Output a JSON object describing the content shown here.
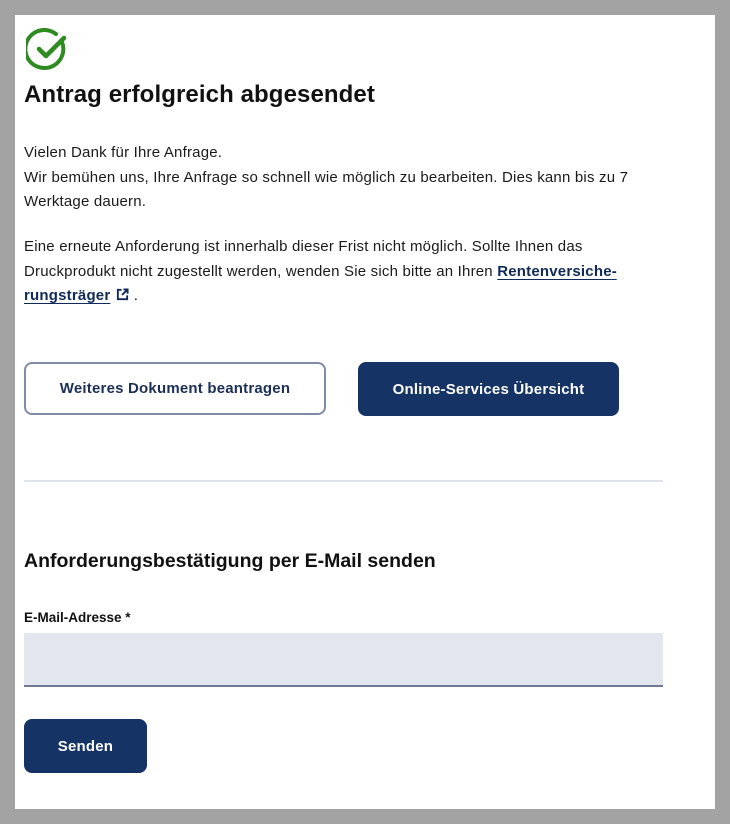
{
  "confirmation": {
    "icon": "check-circle-icon",
    "icon_color": "#2e8b20",
    "title": "Antrag erfolgreich abgesendet",
    "paragraph1": {
      "line1": "Vielen Dank für Ihre Anfrage.",
      "line2": "Wir bemühen uns, Ihre Anfrage so schnell wie möglich zu bearbeiten. Dies kann bis zu 7 Werktage dauern."
    },
    "paragraph2": {
      "text_before_link": "Eine erneute Anforderung ist innerhalb dieser Frist nicht möglich. Sollte Ihnen das Druckprodukt nicht zugestellt werden, wenden Sie sich bitte an Ihren ",
      "link_label": "Rentenversiche­rungsträger",
      "link_icon": "external-link-icon",
      "text_after_link": " ."
    }
  },
  "actions": {
    "secondary_label": "Weiteres Dokument beantragen",
    "primary_label": "Online-Services Übersicht"
  },
  "email_section": {
    "heading": "Anforderungsbestätigung per E-Mail senden",
    "field_label": "E-Mail-Adresse *",
    "field_value": "",
    "submit_label": "Senden"
  },
  "colors": {
    "primary": "#163365",
    "link": "#0f2a57",
    "success": "#2e8b20",
    "input_bg": "#e2e6ef"
  }
}
